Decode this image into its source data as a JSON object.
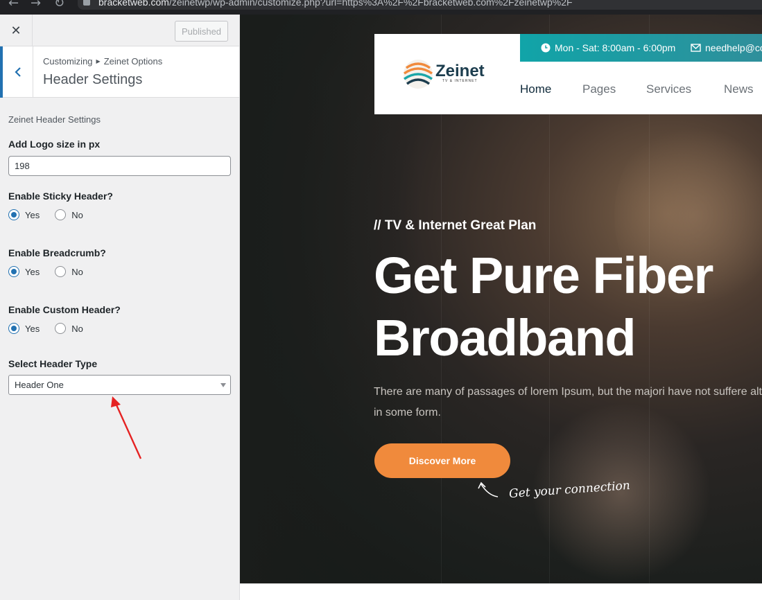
{
  "browser": {
    "url_domain": "bracketweb.com",
    "url_path": "/zeinetwp/wp-admin/customize.php?url=https%3A%2F%2Fbracketweb.com%2Fzeinetwp%2F"
  },
  "customizer": {
    "published_label": "Published",
    "breadcrumb": [
      "Customizing",
      "Zeinet Options"
    ],
    "section_title": "Header Settings",
    "description": "Zeinet Header Settings",
    "logo_size_label": "Add Logo size in px",
    "logo_size_value": "198",
    "sticky_label": "Enable Sticky Header?",
    "breadcrumb_label": "Enable Breadcrumb?",
    "custom_header_label": "Enable Custom Header?",
    "yes_label": "Yes",
    "no_label": "No",
    "sticky_value": "Yes",
    "breadcrumb_value": "Yes",
    "custom_header_value": "Yes",
    "header_type_label": "Select Header Type",
    "header_type_value": "Header One"
  },
  "preview": {
    "logo_text": "Zeinet",
    "logo_tagline": "TV & INTERNET",
    "hours": "Mon - Sat: 8:00am - 6:00pm",
    "email": "needhelp@co",
    "menu": [
      "Home",
      "Pages",
      "Services",
      "News"
    ],
    "eyebrow": "// TV & Internet Great Plan",
    "hero_line1": "Get Pure Fiber",
    "hero_line2": "Broadband",
    "hero_text": "There are many of passages of lorem Ipsum, but the majori have not suffere alteration in some form.",
    "cta_label": "Discover More",
    "script_note": "Get your connection"
  },
  "colors": {
    "wp_accent": "#2271b1",
    "teal_bar": "#11a4a8",
    "cta": "#f08a3c",
    "annotation_arrow": "#e52222"
  },
  "icons": [
    "back-arrow-icon",
    "clock-icon",
    "envelope-icon",
    "close-icon",
    "caret-down-icon"
  ]
}
